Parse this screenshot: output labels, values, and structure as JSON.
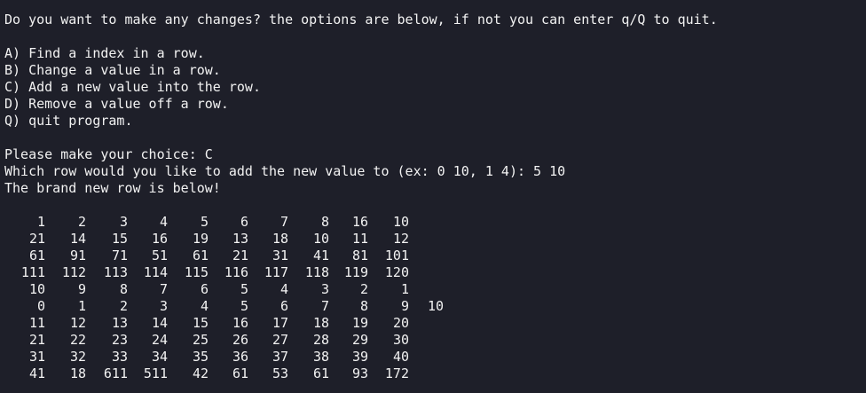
{
  "prompt_intro": "Do you want to make any changes? the options are below, if not you can enter q/Q to quit.",
  "options": [
    "A) Find a index in a row.",
    "B) Change a value in a row.",
    "C) Add a new value into the row.",
    "D) Remove a value off a row.",
    "Q) quit program."
  ],
  "choice_line": "Please make your choice: C",
  "row_prompt_line": "Which row would you like to add the new value to (ex: 0 10, 1 4): 5 10",
  "result_line": "The brand new row is below!",
  "grid": [
    [
      "1",
      "2",
      "3",
      "4",
      "5",
      "6",
      "7",
      "8",
      "16",
      "10"
    ],
    [
      "21",
      "14",
      "15",
      "16",
      "19",
      "13",
      "18",
      "10",
      "11",
      "12"
    ],
    [
      "61",
      "91",
      "71",
      "51",
      "61",
      "21",
      "31",
      "41",
      "81",
      "101"
    ],
    [
      "111",
      "112",
      "113",
      "114",
      "115",
      "116",
      "117",
      "118",
      "119",
      "120"
    ],
    [
      "10",
      "9",
      "8",
      "7",
      "6",
      "5",
      "4",
      "3",
      "2",
      "1"
    ],
    [
      "0",
      "1",
      "2",
      "3",
      "4",
      "5",
      "6",
      "7",
      "8",
      "9",
      "10"
    ],
    [
      "11",
      "12",
      "13",
      "14",
      "15",
      "16",
      "17",
      "18",
      "19",
      "20"
    ],
    [
      "21",
      "22",
      "23",
      "24",
      "25",
      "26",
      "27",
      "28",
      "29",
      "30"
    ],
    [
      "31",
      "32",
      "33",
      "34",
      "35",
      "36",
      "37",
      "38",
      "39",
      "40"
    ],
    [
      "41",
      "18",
      "611",
      "511",
      "42",
      "61",
      "53",
      "61",
      "93",
      "172"
    ]
  ]
}
